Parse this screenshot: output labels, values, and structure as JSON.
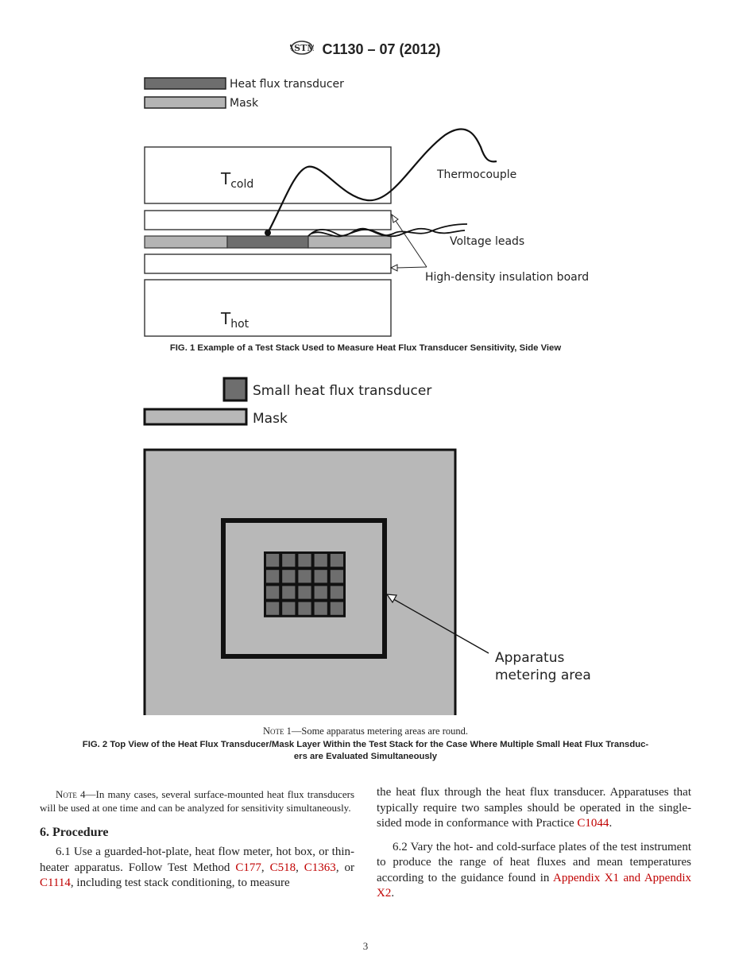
{
  "header": {
    "logo": "astm-logo-icon",
    "standard": "C1130 – 07 (2012)"
  },
  "fig1": {
    "legend": [
      {
        "label": "Heat flux transducer",
        "color": "#6e6e6e"
      },
      {
        "label": "Mask",
        "color": "#b4b4b4"
      }
    ],
    "labels": {
      "t_cold": "T",
      "t_cold_sub": "cold",
      "t_hot": "T",
      "t_hot_sub": "hot",
      "thermocouple": "Thermocouple",
      "voltage_leads": "Voltage leads",
      "insulation": "High-density insulation board"
    },
    "caption": "FIG. 1 Example of a Test Stack Used to Measure Heat Flux Transducer Sensitivity, Side View"
  },
  "fig2": {
    "legend": [
      {
        "label": "Small heat flux transducer",
        "color": "#6e6e6e"
      },
      {
        "label": "Mask",
        "color": "#b8b8b8"
      }
    ],
    "grid": {
      "rows": 4,
      "cols": 5
    },
    "labels": {
      "metering_line1": "Apparatus",
      "metering_line2": "metering area"
    },
    "note_label": "Note",
    "note_text": " 1—Some apparatus metering areas are round.",
    "caption_line1": "FIG. 2 Top View of the Heat Flux Transducer/Mask Layer Within the Test Stack for the Case Where Multiple Small Heat Flux Transduc-",
    "caption_line2": "ers are Evaluated Simultaneously"
  },
  "body": {
    "note4_label": "Note",
    "note4_text": " 4—In many cases, several surface-mounted heat flux transducers will be used at one time and can be analyzed for sensitivity simultaneously.",
    "section_heading": "6.  Procedure",
    "p61_a": "6.1 Use a guarded-hot-plate, heat flow meter, hot box, or thin-heater apparatus. Follow Test Method ",
    "p61_link1": "C177",
    "p61_sep1": ", ",
    "p61_link2": "C518",
    "p61_sep2": ", ",
    "p61_link3": "C1363",
    "p61_sep3": ", or ",
    "p61_link4": "C1114",
    "p61_b": ", including test stack conditioning, to measure the heat flux through the heat flux transducer. Apparatuses that typically require two samples should be operated in the single-sided mode in conformance with Practice ",
    "p61_link5": "C1044",
    "p61_end": ".",
    "p62_a": "6.2 Vary the hot- and cold-surface plates of the test instrument to produce the range of heat fluxes and mean temperatures according to the guidance found in ",
    "p62_link": "Appendix X1 and Appendix X2",
    "p62_end": "."
  },
  "page_number": "3"
}
